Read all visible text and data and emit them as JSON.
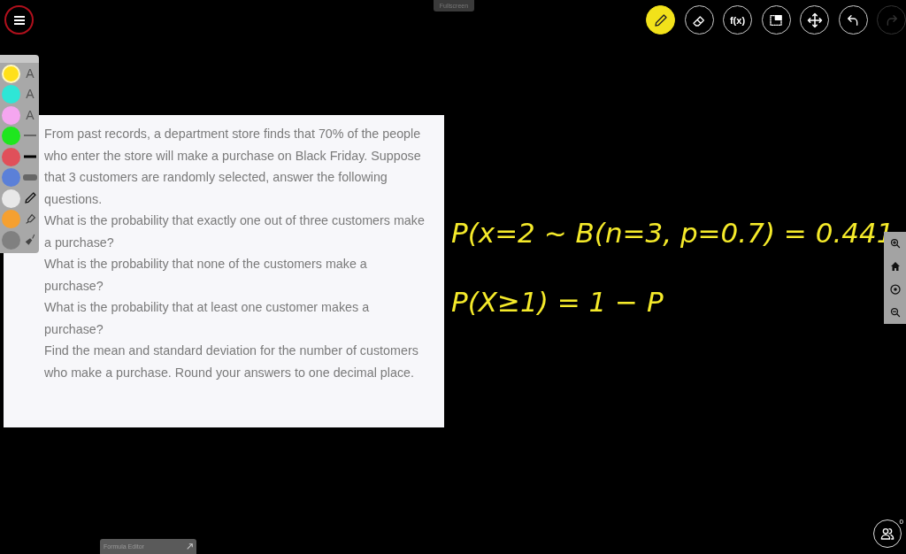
{
  "fullscreen_label": "Fullscreen",
  "toolbar": [
    {
      "kind": "pencil",
      "selected": true,
      "disabled": false
    },
    {
      "kind": "eraser",
      "selected": false,
      "disabled": false
    },
    {
      "kind": "formula",
      "label": "f(x)",
      "selected": false,
      "disabled": false
    },
    {
      "kind": "select",
      "selected": false,
      "disabled": false
    },
    {
      "kind": "move",
      "selected": false,
      "disabled": false
    },
    {
      "kind": "undo",
      "selected": false,
      "disabled": false
    },
    {
      "kind": "redo",
      "selected": false,
      "disabled": true
    }
  ],
  "palette": {
    "colors": [
      {
        "color": "#ffe01a",
        "selected": true
      },
      {
        "color": "#2ee6d6",
        "selected": false
      },
      {
        "color": "#f5a6f0",
        "selected": false
      },
      {
        "color": "#1ee61e",
        "selected": false
      },
      {
        "color": "#e0505a",
        "selected": false
      },
      {
        "color": "#5b80d8",
        "selected": false
      },
      {
        "color": "#e8e8e8",
        "selected": false
      },
      {
        "color": "#f5a030",
        "selected": false
      },
      {
        "color": "#808080",
        "selected": false
      }
    ],
    "tools": [
      {
        "kind": "letter",
        "label": "A"
      },
      {
        "kind": "letter",
        "label": "A"
      },
      {
        "kind": "letter",
        "label": "A"
      },
      {
        "kind": "thin"
      },
      {
        "kind": "medium"
      },
      {
        "kind": "thick"
      },
      {
        "kind": "pencil"
      },
      {
        "kind": "highlighter"
      },
      {
        "kind": "marker"
      }
    ]
  },
  "question_card": {
    "paragraphs": [
      "From past records, a department store finds that 70% of the people who enter the store will make a purchase on Black Friday. Suppose that 3 customers are randomly selected, answer the following questions.",
      "What is the probability that exactly one out of three customers make a purchase?",
      "What is the probability that none of the customers make a purchase?",
      "What is the probability that at least one customer makes a purchase?",
      "Find the mean and standard deviation for the number of customers who make a purchase. Round your answers to one decimal place."
    ]
  },
  "handwriting": [
    "P(x=2 ~ B(n=3, p=0.7) = 0.441",
    "P(X≥1) = 1 − P"
  ],
  "formula_editor_label": "Formula Editor",
  "participants_count": "0"
}
